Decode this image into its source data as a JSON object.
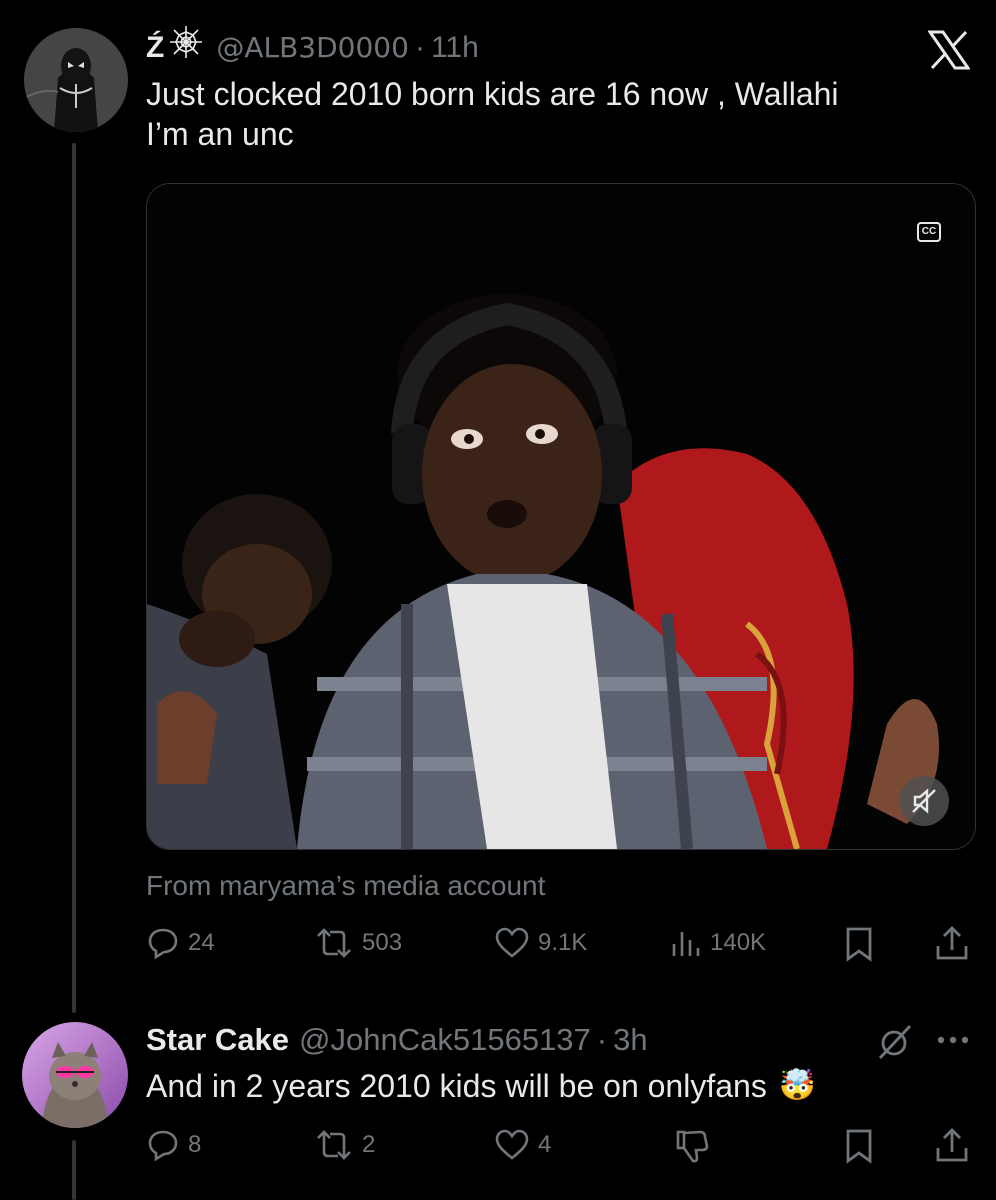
{
  "tweet": {
    "display_name": "Ź",
    "handle": "@ALB3D0000",
    "separator": "·",
    "time": "11h",
    "text_line1": "Just clocked 2010 born kids are 16 now , Wallahi",
    "text_line2": "I’m an unc",
    "media_attribution": "From maryama’s media account",
    "cc_label": "CC",
    "actions": {
      "replies": "24",
      "reposts": "503",
      "likes": "9.1K",
      "views": "140K"
    }
  },
  "reply": {
    "display_name": "Star Cake",
    "handle": "@JohnCak51565137",
    "separator": "·",
    "time": "3h",
    "text": "And in 2 years 2010 kids will be on onlyfans",
    "emoji": "🤯",
    "actions": {
      "replies": "8",
      "reposts": "2",
      "likes": "4"
    }
  },
  "colors": {
    "background": "#000000",
    "text": "#e7e9ea",
    "muted": "#71767b",
    "chair_red": "#b0191c"
  },
  "icons": [
    "x-logo-icon",
    "cobweb-icon",
    "cc-icon",
    "mute-icon",
    "reply-icon",
    "repost-icon",
    "like-icon",
    "views-icon",
    "bookmark-icon",
    "share-icon",
    "grok-icon",
    "more-icon",
    "dislike-icon"
  ]
}
